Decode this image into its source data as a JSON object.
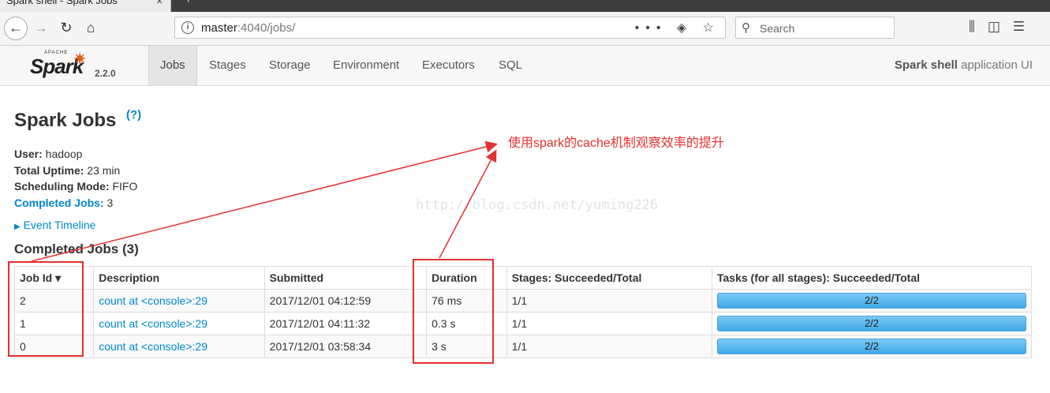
{
  "browser": {
    "tab_title": "Spark shell - Spark Jobs",
    "tab_close": "×",
    "new_tab": "+",
    "url_host": "master",
    "url_path": ":4040/jobs/",
    "url_actions": "••• ◈ ☆",
    "search_placeholder": "Search",
    "icons": [
      "back-icon",
      "forward-icon",
      "reload-icon",
      "home-icon",
      "info-icon",
      "page-actions-icon",
      "pocket-icon",
      "bookmark-star-icon",
      "search-icon",
      "library-icon",
      "sidebar-icon",
      "menu-icon"
    ]
  },
  "spark": {
    "logo_apache": "APACHE",
    "logo_text": "Spark",
    "version": "2.2.0",
    "tabs": [
      "Jobs",
      "Stages",
      "Storage",
      "Environment",
      "Executors",
      "SQL"
    ],
    "active_tab": "Jobs",
    "app_name": "Spark shell",
    "app_suffix": " application UI"
  },
  "page": {
    "title": "Spark Jobs",
    "help": "(?)",
    "summary": {
      "user_label": "User:",
      "user_value": " hadoop",
      "uptime_label": "Total Uptime:",
      "uptime_value": " 23 min",
      "mode_label": "Scheduling Mode:",
      "mode_value": " FIFO",
      "completed_label": "Completed Jobs:",
      "completed_value": " 3"
    },
    "event_timeline": "Event Timeline",
    "section_title": "Completed Jobs (3)",
    "table": {
      "headers": [
        "Job Id ▾",
        "Description",
        "Submitted",
        "Duration",
        "Stages: Succeeded/Total",
        "Tasks (for all stages): Succeeded/Total"
      ],
      "rows": [
        {
          "id": "2",
          "description": "count at <console>:29",
          "submitted": "2017/12/01 04:12:59",
          "duration": "76 ms",
          "stages": "1/1",
          "tasks": "2/2",
          "tasks_fraction": 1.0
        },
        {
          "id": "1",
          "description": "count at <console>:29",
          "submitted": "2017/12/01 04:11:32",
          "duration": "0.3 s",
          "stages": "1/1",
          "tasks": "2/2",
          "tasks_fraction": 1.0
        },
        {
          "id": "0",
          "description": "count at <console>:29",
          "submitted": "2017/12/01 03:58:34",
          "duration": "3 s",
          "stages": "1/1",
          "tasks": "2/2",
          "tasks_fraction": 1.0
        }
      ]
    }
  },
  "overlay": {
    "annotation": "使用spark的cache机制观察效率的提升",
    "watermark": "http://blog.csdn.net/yuming226",
    "color": "#e53030"
  }
}
